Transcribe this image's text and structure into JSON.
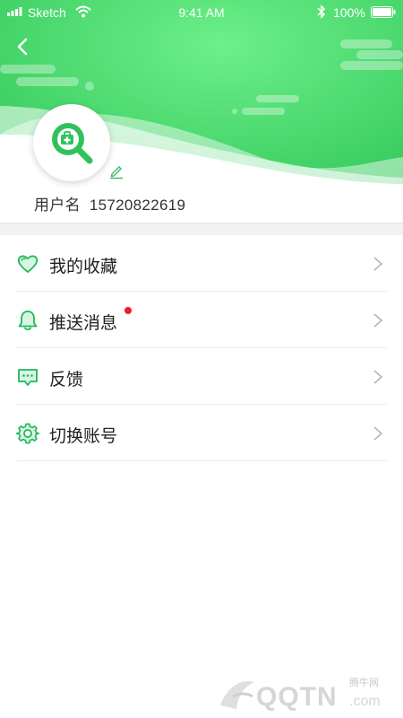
{
  "colors": {
    "brand_green": "#3ecf63",
    "brand_green_light": "#5be27c",
    "icon_green": "#1fb85a",
    "badge_red": "#f21b2a"
  },
  "status_bar": {
    "carrier": "Sketch",
    "time": "9:41 AM",
    "battery": "100%",
    "icons": [
      "signal-icon",
      "wifi-icon",
      "bluetooth-icon",
      "battery-icon"
    ]
  },
  "header": {
    "back_icon": "back-arrow-icon",
    "avatar_icon": "medical-search-icon",
    "edit_icon": "pencil-icon"
  },
  "profile": {
    "username_label": "用户名",
    "username_value": "15720822619"
  },
  "menu": {
    "items": [
      {
        "label": "我的收藏",
        "icon": "heart-icon",
        "badge": false
      },
      {
        "label": "推送消息",
        "icon": "bell-icon",
        "badge": true
      },
      {
        "label": "反馈",
        "icon": "feedback-chat-icon",
        "badge": false
      },
      {
        "label": "切换账号",
        "icon": "gear-icon",
        "badge": false
      }
    ]
  },
  "watermark": {
    "brand_cn": "腾牛网",
    "brand_en": "QQTN",
    "domain": ".com"
  }
}
